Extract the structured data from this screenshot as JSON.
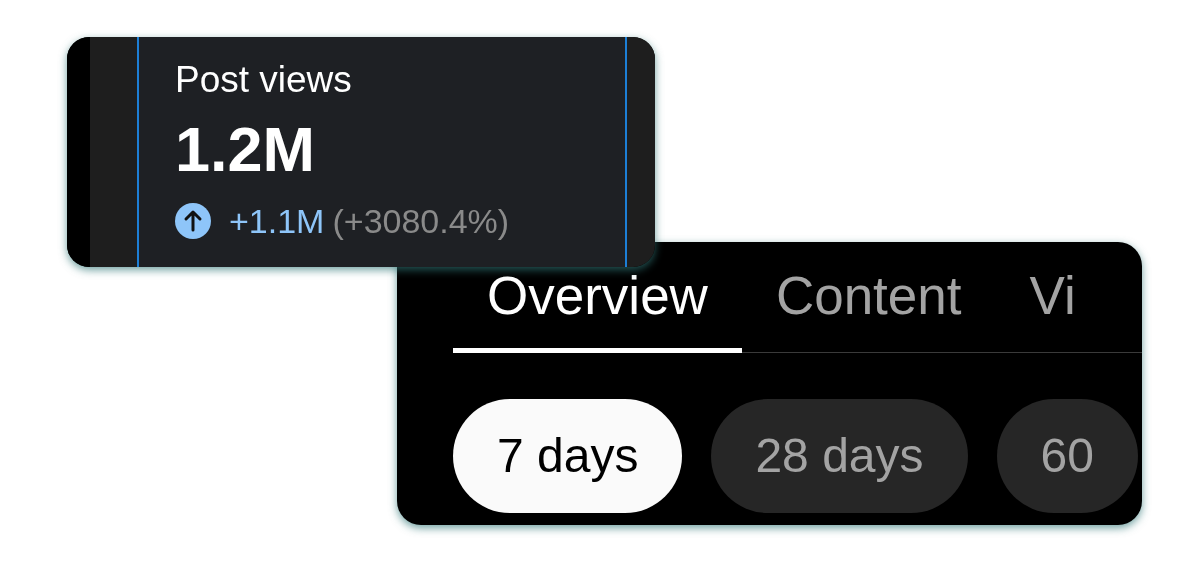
{
  "stat_card": {
    "label": "Post views",
    "value": "1.2M",
    "change": "+1.1M",
    "change_percent": "(+3080.4%)"
  },
  "tabs": [
    {
      "label": "Overview",
      "selected": true
    },
    {
      "label": "Content",
      "selected": false
    },
    {
      "label": "Vi",
      "selected": false
    }
  ],
  "ranges": [
    {
      "label": "7 days",
      "selected": true
    },
    {
      "label": "28 days",
      "selected": false
    },
    {
      "label": "60",
      "selected": false
    }
  ]
}
